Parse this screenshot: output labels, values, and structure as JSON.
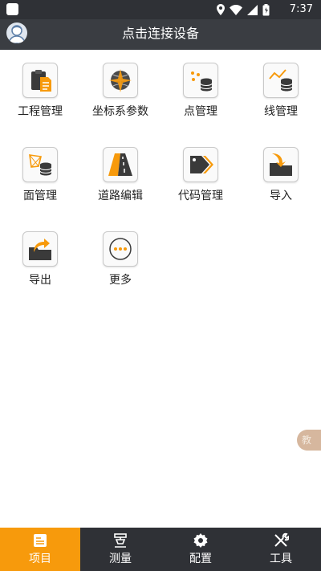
{
  "status_bar": {
    "time": "7:37"
  },
  "header": {
    "title": "点击连接设备"
  },
  "menu": [
    {
      "label": "工程管理",
      "icon": "project-clipboard-icon"
    },
    {
      "label": "坐标系参数",
      "icon": "globe-coordinate-icon"
    },
    {
      "label": "点管理",
      "icon": "points-database-icon"
    },
    {
      "label": "线管理",
      "icon": "line-database-icon"
    },
    {
      "label": "面管理",
      "icon": "polygon-database-icon"
    },
    {
      "label": "道路编辑",
      "icon": "road-edit-icon"
    },
    {
      "label": "代码管理",
      "icon": "code-tag-icon"
    },
    {
      "label": "导入",
      "icon": "import-folder-icon"
    },
    {
      "label": "导出",
      "icon": "export-folder-icon"
    },
    {
      "label": "更多",
      "icon": "more-dots-icon"
    }
  ],
  "float_tab": {
    "label": "教"
  },
  "tabs": [
    {
      "label": "项目",
      "icon": "project-icon",
      "active": true
    },
    {
      "label": "测量",
      "icon": "survey-instrument-icon",
      "active": false
    },
    {
      "label": "配置",
      "icon": "gear-icon",
      "active": false
    },
    {
      "label": "工具",
      "icon": "tools-icon",
      "active": false
    }
  ],
  "colors": {
    "accent": "#f79a0c",
    "bar": "#2f3136",
    "header": "#3a3d42"
  }
}
